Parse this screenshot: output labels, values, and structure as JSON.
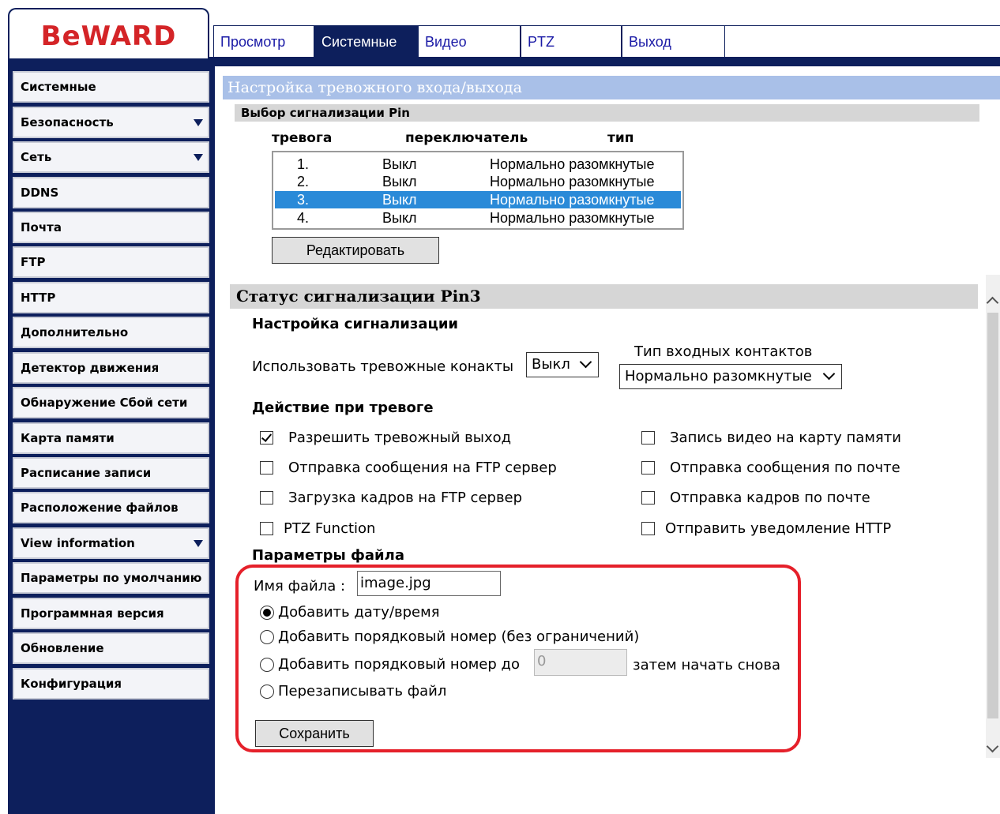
{
  "logo": {
    "text": "BeWARD"
  },
  "tabs": [
    {
      "label": "Просмотр"
    },
    {
      "label": "Системные"
    },
    {
      "label": "Видео"
    },
    {
      "label": "PTZ"
    },
    {
      "label": "Выход"
    }
  ],
  "active_tab": "Системные",
  "sidebar": {
    "items": [
      {
        "label": "Системные"
      },
      {
        "label": "Безопасность"
      },
      {
        "label": "Сеть"
      },
      {
        "label": "DDNS"
      },
      {
        "label": "Почта"
      },
      {
        "label": "FTP"
      },
      {
        "label": "HTTP"
      },
      {
        "label": "Дополнительно"
      },
      {
        "label": "Детектор движения"
      },
      {
        "label": "Обнаружение Сбой сети"
      },
      {
        "label": "Карта памяти"
      },
      {
        "label": "Расписание записи"
      },
      {
        "label": "Расположение файлов"
      },
      {
        "label": "View information"
      },
      {
        "label": "Параметры по умолчанию"
      },
      {
        "label": "Программная версия"
      },
      {
        "label": "Обновление"
      },
      {
        "label": "Конфигурация"
      }
    ]
  },
  "main": {
    "title": "Настройка тревожного входа/выхода",
    "pin_select_title": "Выбор сигнализации Pin",
    "columns": {
      "alarm": "тревога",
      "switch": "переключатель",
      "type": "тип"
    },
    "pins": [
      {
        "num": "1.",
        "state": "Выкл",
        "type": "Нормально разомкнутые"
      },
      {
        "num": "2.",
        "state": "Выкл",
        "type": "Нормально разомкнутые"
      },
      {
        "num": "3.",
        "state": "Выкл",
        "type": "Нормально разомкнутые"
      },
      {
        "num": "4.",
        "state": "Выкл",
        "type": "Нормально разомкнутые"
      }
    ],
    "selected_pin": "3.",
    "edit_button": "Редактировать",
    "status_title": "Статус сигнализации Pin3",
    "alarm_settings": {
      "title": "Настройка сигнализации",
      "use_contacts_label": "Использовать тревожные конакты",
      "use_contacts_value": "Выкл",
      "input_type_label": "Тип входных контактов",
      "input_type_value": "Нормально разомкнутые"
    },
    "actions": {
      "title": "Действие при тревоге",
      "left": [
        {
          "label": "Разрешить тревожный выход",
          "checked": true
        },
        {
          "label": "Отправка сообщения на FTP сервер",
          "checked": false
        },
        {
          "label": "Загрузка кадров на FTP сервер",
          "checked": false
        },
        {
          "label": "PTZ Function",
          "checked": false
        }
      ],
      "right": [
        {
          "label": "Запись видео на карту памяти",
          "checked": false
        },
        {
          "label": "Отправка сообщения по почте",
          "checked": false
        },
        {
          "label": "Отправка кадров по почте",
          "checked": false
        },
        {
          "label": "Отправить уведомление HTTP",
          "checked": false
        }
      ]
    },
    "file_params": {
      "title": "Параметры файла",
      "filename_label": "Имя файла :",
      "filename_value": "image.jpg",
      "options": [
        {
          "label": "Добавить дату/время",
          "checked": true
        },
        {
          "label": "Добавить порядковый номер (без ограничений)",
          "checked": false
        },
        {
          "label": "Добавить порядковый номер до",
          "checked": false
        },
        {
          "label": "Перезаписывать файл",
          "checked": false
        }
      ],
      "seq_limit_value": "0",
      "seq_suffix": "затем начать снова",
      "save_button": "Сохранить"
    }
  },
  "colors": {
    "navy": "#0d1f5c",
    "title_bar": "#a9c0e8",
    "selected_row": "#2a8ad8",
    "highlight": "#e5202a",
    "logo": "#d42427"
  }
}
